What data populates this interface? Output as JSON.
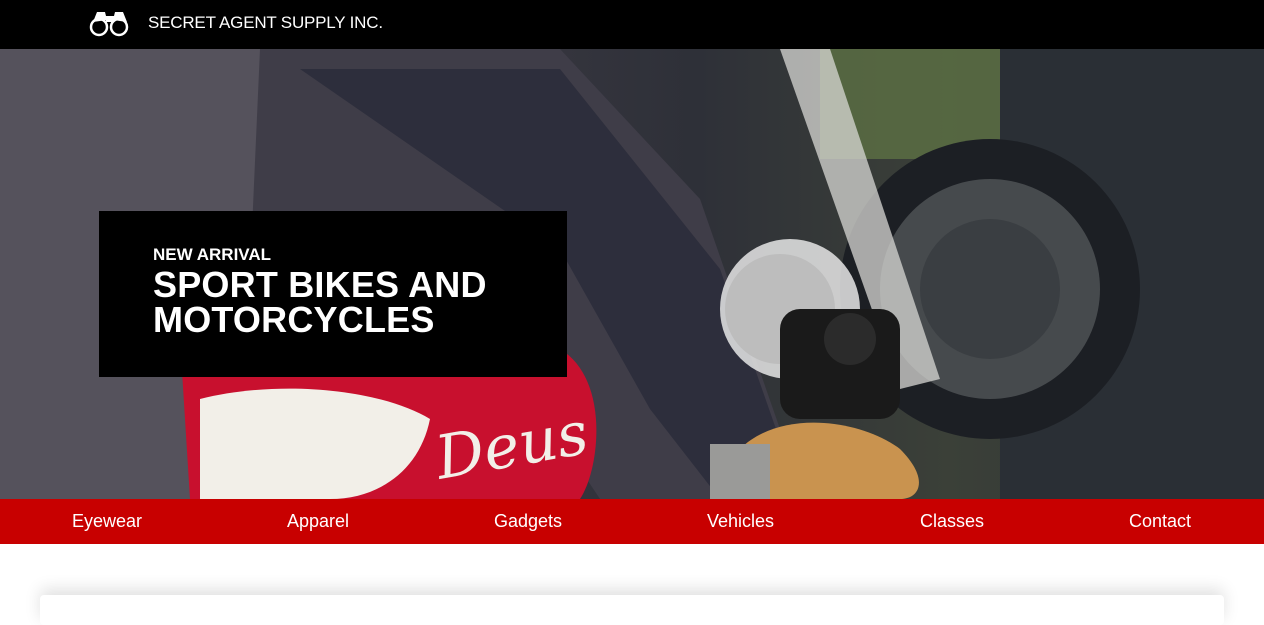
{
  "header": {
    "brand": "SECRET AGENT SUPPLY INC.",
    "logo_icon": "binoculars-icon"
  },
  "hero": {
    "kicker": "NEW ARRIVAL",
    "headline_line1": "SPORT BIKES AND",
    "headline_line2": "MOTORCYCLES",
    "tank_lettering": "Deus"
  },
  "nav": {
    "items": [
      {
        "label": "Eyewear"
      },
      {
        "label": "Apparel"
      },
      {
        "label": "Gadgets"
      },
      {
        "label": "Vehicles"
      },
      {
        "label": "Classes"
      },
      {
        "label": "Contact"
      }
    ]
  },
  "colors": {
    "topbar": "#000000",
    "nav_background": "#c80000",
    "promo_background": "#000000",
    "text": "#ffffff"
  }
}
